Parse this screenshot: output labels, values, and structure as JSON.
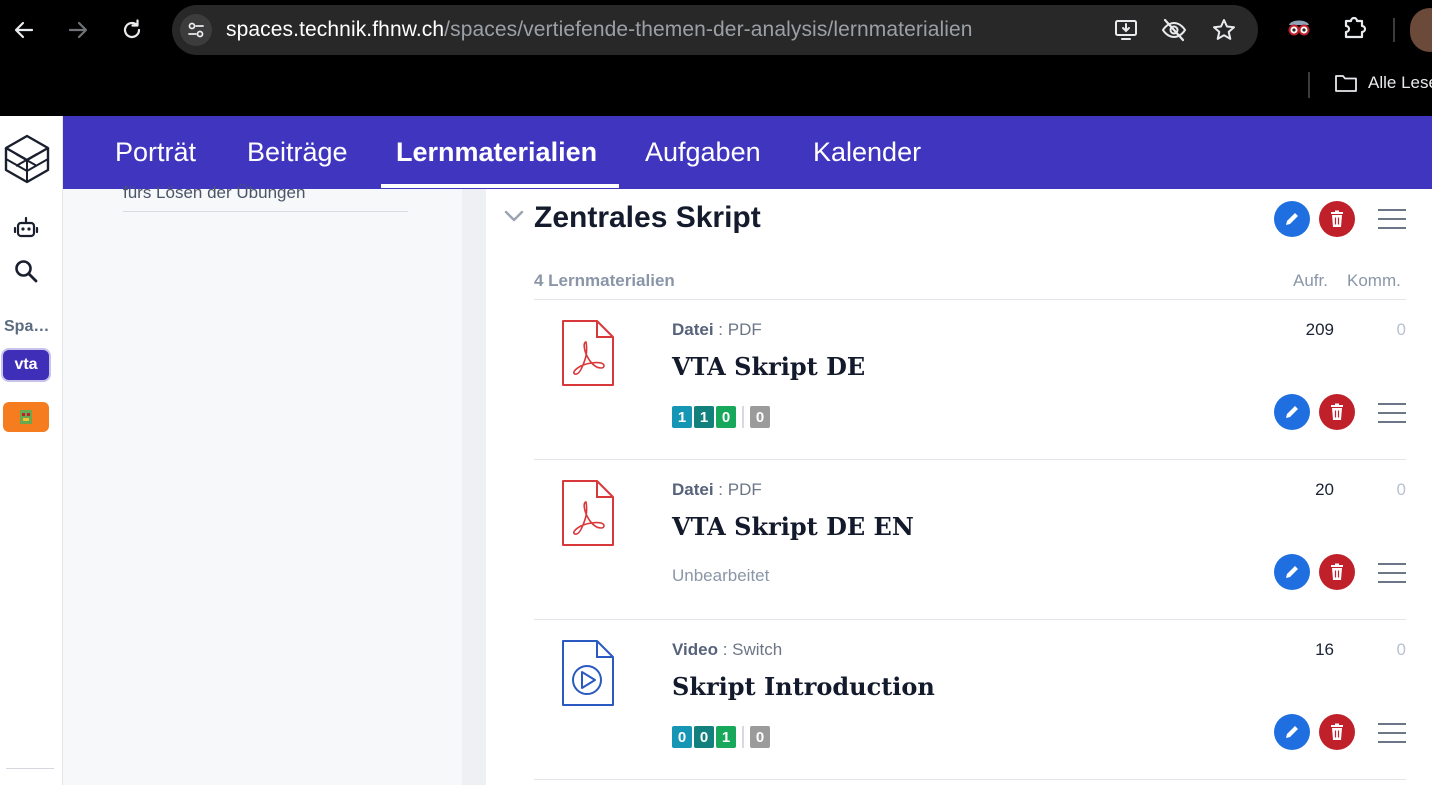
{
  "browser": {
    "url_host": "spaces.technik.fhnw.ch",
    "url_path": "/spaces/vertiefende-themen-der-analysis/lernmaterialien",
    "bookmark_folder": "Alle Lese"
  },
  "rail": {
    "spaces_label": "Spa…",
    "chip_label": "vta"
  },
  "tabs": [
    {
      "label": "Porträt"
    },
    {
      "label": "Beiträge"
    },
    {
      "label": "Lernmaterialien"
    },
    {
      "label": "Aufgaben"
    },
    {
      "label": "Kalender"
    }
  ],
  "panel": {
    "text": "fürs Lösen der Übungen"
  },
  "section": {
    "title": "Zentrales Skript",
    "count_label": "4 Lernmaterialien",
    "col_views": "Aufr.",
    "col_comments": "Komm."
  },
  "items": [
    {
      "kind": "Datei",
      "sep": " : ",
      "type": "PDF",
      "title": "VTA Skript DE",
      "views": "209",
      "comments": "0",
      "badges": [
        "1",
        "1",
        "0"
      ],
      "badge_extra": "0",
      "icon": "pdf-file-icon"
    },
    {
      "kind": "Datei",
      "sep": " : ",
      "type": "PDF",
      "title": "VTA Skript DE EN",
      "views": "20",
      "comments": "0",
      "status": "Unbearbeitet",
      "icon": "pdf-file-icon"
    },
    {
      "kind": "Video",
      "sep": " : ",
      "type": "Switch",
      "title": "Skript Introduction",
      "views": "16",
      "comments": "0",
      "badges": [
        "0",
        "0",
        "1"
      ],
      "badge_extra": "0",
      "icon": "video-file-icon"
    }
  ],
  "colors": {
    "brand": "#4035bf",
    "edit": "#1f6fe0",
    "delete": "#c0202a",
    "pdf": "#d9383a",
    "video": "#2b59c3"
  }
}
